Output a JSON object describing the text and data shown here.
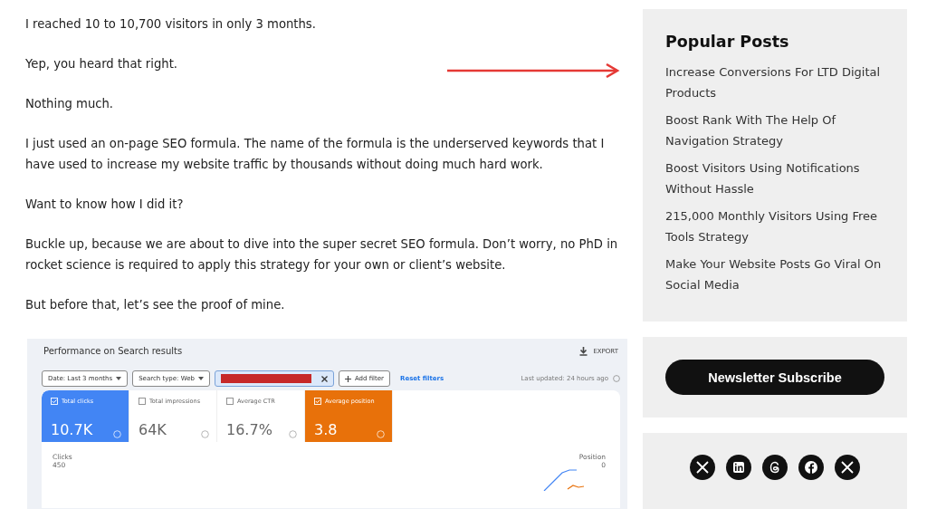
{
  "article": {
    "paragraphs": [
      "I reached 10 to 10,700 visitors in only 3 months.",
      "Yep, you heard that right.",
      "Nothing much.",
      "I just used an on-page SEO formula. The name of the formula is the underserved keywords that I have used to increase my website traffic by thousands without doing much hard work.",
      "Want to know how I did it?",
      "Buckle up, because we are about to dive into the super secret SEO formula. Don’t worry, no PhD in rocket science is required to apply this strategy for your own or client’s website.",
      "But before that, let’s see the proof of mine."
    ],
    "screenshot": {
      "title": "Performance on Search results",
      "export": "EXPORT",
      "filters": [
        {
          "kind": "dropdown",
          "label": "Date: Last 3 months"
        },
        {
          "kind": "dropdown",
          "label": "Search type: Web"
        },
        {
          "kind": "redacted"
        },
        {
          "kind": "add",
          "label": "Add filter"
        },
        {
          "kind": "link",
          "label": "Reset filters"
        }
      ],
      "updated": "Last updated: 24 hours ago",
      "metrics": [
        {
          "label": "Total clicks",
          "value": "10.7K",
          "checked": true,
          "color": "#4285f4"
        },
        {
          "label": "Total impressions",
          "value": "64K",
          "checked": false,
          "color": "#ffffff"
        },
        {
          "label": "Average CTR",
          "value": "16.7%",
          "checked": false,
          "color": "#ffffff"
        },
        {
          "label": "Average position",
          "value": "3.8",
          "checked": true,
          "color": "#e8710a"
        }
      ],
      "chart": {
        "left_axis": "Clicks",
        "left_tick": "450",
        "right_axis": "Position",
        "right_tick": "0"
      }
    }
  },
  "sidebar": {
    "popular": {
      "title": "Popular Posts",
      "posts": [
        "Increase Conversions For LTD Digital Products",
        "Boost Rank With The Help Of Navigation Strategy",
        "Boost Visitors Using Notifications Without Hassle",
        "215,000 Monthly Visitors Using Free Tools Strategy",
        "Make Your Website Posts Go Viral On Social Media"
      ]
    },
    "newsletter": {
      "button": "Newsletter Subscribe"
    },
    "social": [
      {
        "kind": "x"
      },
      {
        "kind": "linkedin"
      },
      {
        "kind": "threads"
      },
      {
        "kind": "facebook"
      },
      {
        "kind": "x"
      }
    ]
  }
}
